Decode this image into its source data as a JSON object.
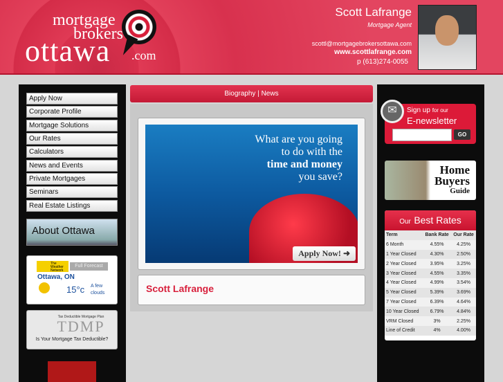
{
  "logo": {
    "line1": "mortgage",
    "line2": "brokers",
    "line3": "ottawa",
    "line4": ".com"
  },
  "agent": {
    "name": "Scott Lafrange",
    "title": "Mortgage Agent",
    "email": "scottl@mortgagebrokersottawa.com",
    "website": "www.scottlafrange.com",
    "phone": "p (613)274-0055"
  },
  "nav": [
    "Apply Now",
    "Corporate Profile",
    "Mortgage Solutions",
    "Our Rates",
    "Calculators",
    "News and Events",
    "Private Mortgages",
    "Seminars",
    "Real Estate Listings"
  ],
  "about": "About Ottawa",
  "weather": {
    "brand": "The Weather Network",
    "button": "Full Forecast",
    "city": "Ottawa, ON",
    "temp": "15°c",
    "condition": "A few clouds"
  },
  "tdmp": {
    "title": "Tax Deductible Mortgage Plan",
    "logo": "TDMP",
    "tagline": "Is Your Mortgage Tax Deductible?"
  },
  "center": {
    "bar": "Biography | News",
    "hero_lines": [
      "What are you going",
      "to do with the",
      "time and money",
      "you save?"
    ],
    "apply": "Apply Now!",
    "name": "Scott Lafrange"
  },
  "newsletter": {
    "line1": "Sign up",
    "line1b": "for our",
    "line2": "E-newsletter",
    "go": "GO",
    "placeholder": ""
  },
  "homebuyers": {
    "line1": "Home",
    "line2": "Buyers",
    "line3": "Guide"
  },
  "rates": {
    "title_small": "Our",
    "title": "Best Rates",
    "headers": [
      "Term",
      "Bank Rate",
      "Our Rate"
    ],
    "rows": [
      [
        "6 Month",
        "4.55%",
        "4.25%"
      ],
      [
        "1 Year Closed",
        "4.30%",
        "2.50%"
      ],
      [
        "2 Year Closed",
        "3.95%",
        "3.25%"
      ],
      [
        "3 Year Closed",
        "4.55%",
        "3.35%"
      ],
      [
        "4 Year Closed",
        "4.99%",
        "3.54%"
      ],
      [
        "5 Year Closed",
        "5.39%",
        "3.69%"
      ],
      [
        "7 Year Closed",
        "6.39%",
        "4.64%"
      ],
      [
        "10 Year Closed",
        "6.79%",
        "4.84%"
      ],
      [
        "VRM Closed",
        "3%",
        "2.25%"
      ],
      [
        "Line of Credit",
        "4%",
        "4.00%"
      ]
    ]
  },
  "colors": {
    "brand_red": "#d8304c"
  }
}
